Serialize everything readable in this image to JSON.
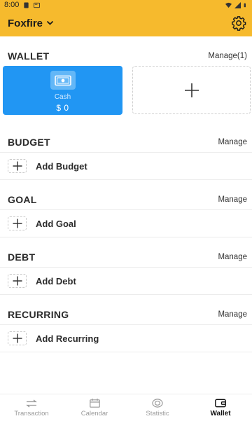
{
  "status_bar": {
    "time": "8:00"
  },
  "app_bar": {
    "title": "Foxfire"
  },
  "wallet": {
    "title": "WALLET",
    "manage_label": "Manage(1)",
    "card": {
      "name": "Cash",
      "amount": "$ 0"
    }
  },
  "budget": {
    "title": "BUDGET",
    "manage_label": "Manage",
    "add_label": "Add Budget"
  },
  "goal": {
    "title": "GOAL",
    "manage_label": "Manage",
    "add_label": "Add Goal"
  },
  "debt": {
    "title": "DEBT",
    "manage_label": "Manage",
    "add_label": "Add Debt"
  },
  "recurring": {
    "title": "RECURRING",
    "manage_label": "Manage",
    "add_label": "Add Recurring"
  },
  "bottom_nav": [
    {
      "label": "Transaction",
      "icon": "transfer-arrows-icon",
      "active": false
    },
    {
      "label": "Calendar",
      "icon": "calendar-icon",
      "active": false
    },
    {
      "label": "Statistic",
      "icon": "chart-circle-icon",
      "active": false
    },
    {
      "label": "Wallet",
      "icon": "wallet-icon",
      "active": true
    }
  ],
  "colors": {
    "accent": "#f6ba2d",
    "card": "#2196f3"
  }
}
